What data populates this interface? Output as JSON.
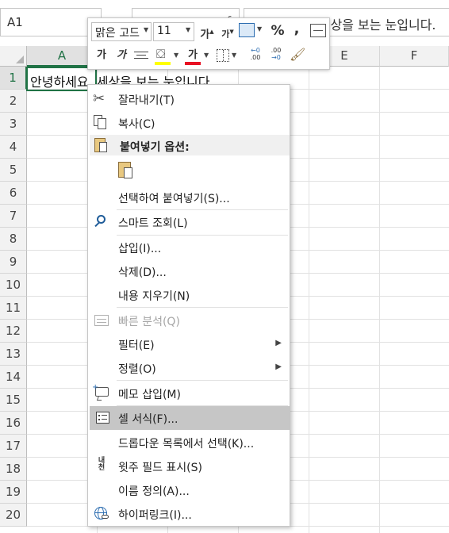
{
  "formula_bar": {
    "name_box": "A1",
    "formula": "안녕하세요. 세상을 보는 눈입니다."
  },
  "sheet": {
    "columns": [
      "A",
      "B",
      "C",
      "D",
      "E",
      "F"
    ],
    "rows": [
      "1",
      "2",
      "3",
      "4",
      "5",
      "6",
      "7",
      "8",
      "9",
      "10",
      "11",
      "12",
      "13",
      "14",
      "15",
      "16",
      "17",
      "18",
      "19",
      "20"
    ],
    "a1_value": "안녕하세요. 세상을 보는 눈입니다."
  },
  "mini_toolbar": {
    "font_name": "맑은 고드",
    "font_size": "11",
    "increase_font": "가",
    "decrease_font": "가",
    "percent": "%",
    "comma": ",",
    "bold": "가",
    "italic": "가",
    "font_color_glyph": "가",
    "inc_decimal": ".00",
    "dec_decimal": ".00",
    "font_color": "#e81123",
    "highlight_color": "#ffff00"
  },
  "context_menu": {
    "cut": "잘라내기(T)",
    "copy": "복사(C)",
    "paste_options": "붙여넣기 옵션:",
    "paste_special": "선택하여 붙여넣기(S)...",
    "smart_lookup": "스마트 조회(L)",
    "insert": "삽입(I)...",
    "delete": "삭제(D)...",
    "clear": "내용 지우기(N)",
    "quick_analysis": "빠른 분석(Q)",
    "filter": "필터(E)",
    "sort": "정렬(O)",
    "insert_note": "메모 삽입(M)",
    "format_cells": "셀 서식(F)...",
    "dropdown_pick": "드롭다운 목록에서 선택(K)...",
    "phonetic": "윗주 필드 표시(S)",
    "define_name": "이름 정의(A)...",
    "hyperlink": "하이퍼링크(I)..."
  },
  "colors": {
    "accent": "#217346",
    "highlight": "#c6c6c6"
  }
}
